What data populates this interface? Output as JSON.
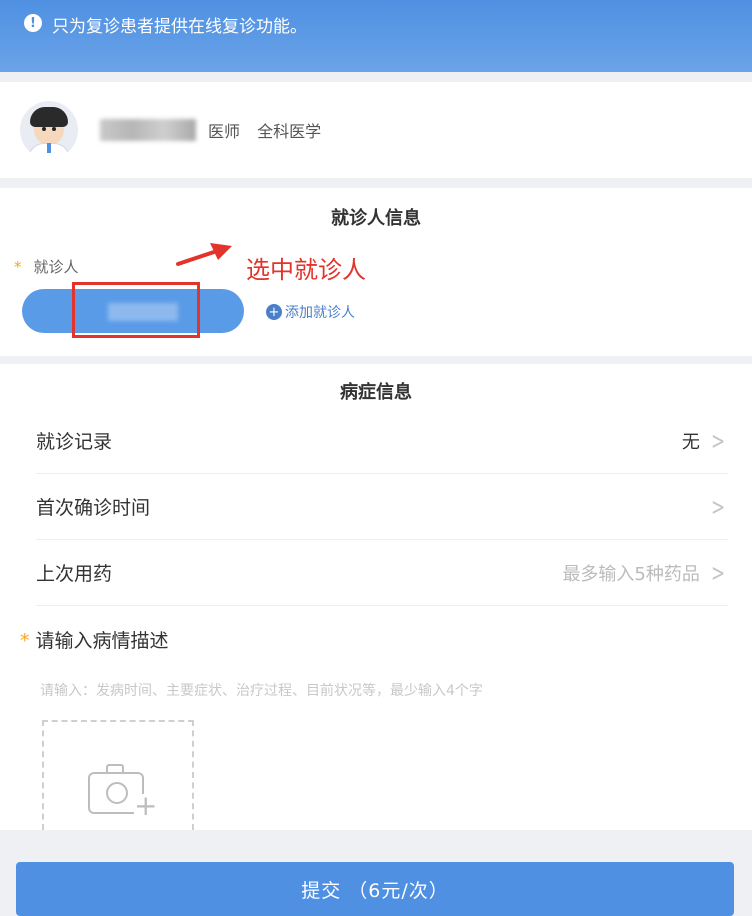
{
  "notice": {
    "text": "只为复诊患者提供在线复诊功能。"
  },
  "doctor": {
    "title": "医师",
    "department": "全科医学"
  },
  "patient_section": {
    "title": "就诊人信息",
    "label": "就诊人",
    "annotation": "选中就诊人",
    "add_label": "添加就诊人"
  },
  "condition_section": {
    "title": "病症信息",
    "rows": [
      {
        "label": "就诊记录",
        "value": "无"
      },
      {
        "label": "首次确诊时间",
        "value": ""
      },
      {
        "label": "上次用药",
        "placeholder": "最多输入5种药品"
      }
    ],
    "desc_label": "请输入病情描述",
    "desc_placeholder": "请输入：发病时间、主要症状、治疗过程、目前状况等，最少输入4个字"
  },
  "submit": {
    "label": "提交 （6元/次）"
  },
  "colors": {
    "brand_blue": "#4f90e2",
    "annotation_red": "#e2342b",
    "required_star": "#f5a623"
  },
  "icons": [
    "info-icon",
    "doctor-avatar",
    "arrow-annotation",
    "add-circle-icon",
    "chevron-right-icon",
    "camera-add-icon"
  ]
}
